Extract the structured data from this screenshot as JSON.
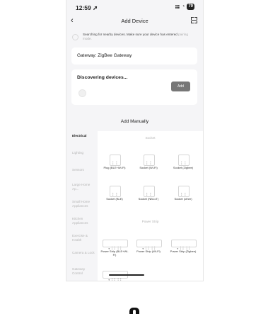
{
  "status": {
    "time": "12:59 ➚",
    "signal": "𝍖",
    "wifi": "◔",
    "battery": "79"
  },
  "nav": {
    "back": "‹",
    "title": "Add Device"
  },
  "search": {
    "text_prefix": "Searching for nearby devices. Make sure your device has entered ",
    "text_link": "pairing mode."
  },
  "gateway": {
    "label": "Gateway: ZigBee Gateway"
  },
  "discover": {
    "title": "Discovering devices...",
    "add": "Add"
  },
  "add_manually": "Add Manually",
  "categories": [
    {
      "label": "Electrical",
      "active": true
    },
    {
      "label": "Lighting"
    },
    {
      "label": "Sensors"
    },
    {
      "label": "Large Home Ap..."
    },
    {
      "label": "Small Home Appliances"
    },
    {
      "label": "Kitchen Appliances"
    },
    {
      "label": "Exercise & Health"
    },
    {
      "label": "Camera & Lock"
    },
    {
      "label": "Gateway Control"
    }
  ],
  "sections": {
    "socket": "Socket",
    "strip": "Power Strip"
  },
  "socket_tiles": [
    {
      "label": "Plug (BLE+Wi-Fi)"
    },
    {
      "label": "Socket (Wi-Fi)"
    },
    {
      "label": "Socket (Zigbee)"
    },
    {
      "label": "Socket (BLE)"
    },
    {
      "label": "Socket (NB-IoT)"
    },
    {
      "label": "Socket (other)"
    }
  ],
  "strip_tiles": [
    {
      "label": "Power Strip (BLE+Wi-Fi)"
    },
    {
      "label": "Power Strip (Wi-Fi)"
    },
    {
      "label": "Power Strip (Zigbee)"
    }
  ],
  "glyphs": {
    "socket": "⠅ ⠅",
    "strip": "∘ ⠅⠅ ⠅⠅"
  }
}
